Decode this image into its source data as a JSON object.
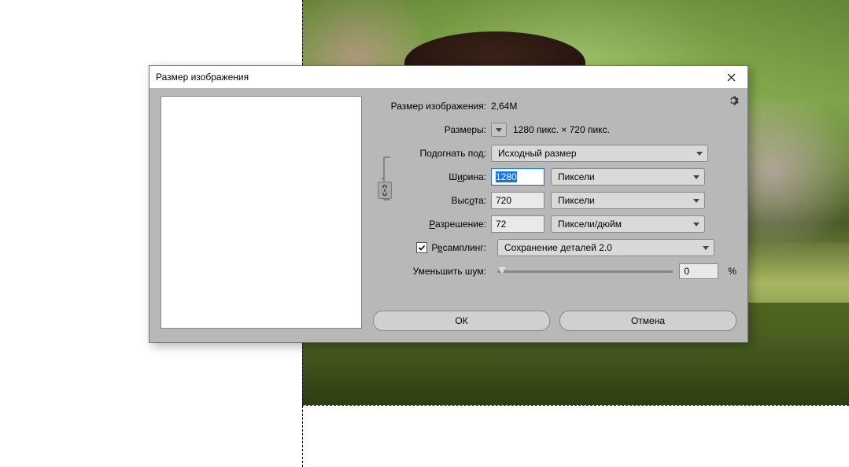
{
  "dialog": {
    "title": "Размер изображения",
    "imageSize": {
      "label": "Размер изображения:",
      "value": "2,64M"
    },
    "dimensions": {
      "label": "Размеры:",
      "value": "1280 пикс. × 720 пикс."
    },
    "fitTo": {
      "label": "Подогнать под:",
      "value": "Исходный размер"
    },
    "width": {
      "label": "Ширина:",
      "value": "1280",
      "unit": "Пиксели"
    },
    "height": {
      "label": "Высота:",
      "value": "720",
      "unit": "Пиксели"
    },
    "resolution": {
      "label": "Разрешение:",
      "value": "72",
      "unit": "Пиксели/дюйм"
    },
    "resample": {
      "label": "Ресамплинг:",
      "checked": true,
      "value": "Сохранение деталей 2.0"
    },
    "noise": {
      "label": "Уменьшить шум:",
      "value": "0",
      "suffix": "%"
    },
    "buttons": {
      "ok": "ОК",
      "cancel": "Отмена"
    }
  }
}
